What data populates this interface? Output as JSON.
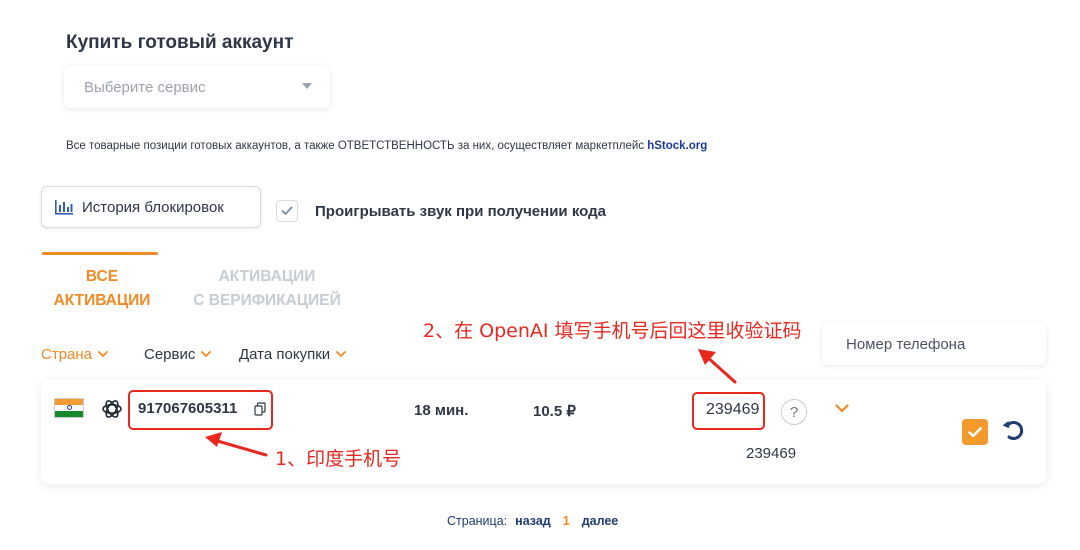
{
  "page": {
    "title": "Купить готовый аккаунт",
    "service_select_placeholder": "Выберите сервис",
    "notice_text": "Все товарные позиции готовых аккаунтов, а также ОТВЕТСТВЕННОСТЬ за них, осуществляет маркетплейс ",
    "notice_link": "hStock.org"
  },
  "toolbar": {
    "history_label": "История блокировок",
    "sound_label": "Проигрывать звук при получении кода",
    "sound_checked": true
  },
  "tabs": [
    {
      "line1": "ВСЕ",
      "line2": "АКТИВАЦИИ",
      "active": true
    },
    {
      "line1": "АКТИВАЦИИ",
      "line2": "С ВЕРИФИКАЦИЕЙ",
      "active": false
    }
  ],
  "filters": [
    {
      "label": "Страна",
      "color": "#f08a24"
    },
    {
      "label": "Сервис",
      "color": "#2d3748"
    },
    {
      "label": "Дата покупки",
      "color": "#2d3748"
    }
  ],
  "search": {
    "placeholder": "Номер телефона"
  },
  "activation": {
    "country_flag": "india-flag",
    "service_icon": "openai-icon",
    "phone": "917067605311",
    "time": "18 мин.",
    "price": "10.5 ₽",
    "code": "239469",
    "help": "?",
    "code_history": "239469",
    "status_checked": true
  },
  "pagination": {
    "label": "Страница:",
    "prev": "назад",
    "current": "1",
    "next": "далее"
  },
  "annotations": {
    "note1": "1、印度手机号",
    "note2": "2、在 OpenAI 填写手机号后回这里收验证码"
  },
  "colors": {
    "accent": "#f08a24",
    "annotation_red": "#e8281f",
    "link_blue": "#1a3a9a"
  }
}
